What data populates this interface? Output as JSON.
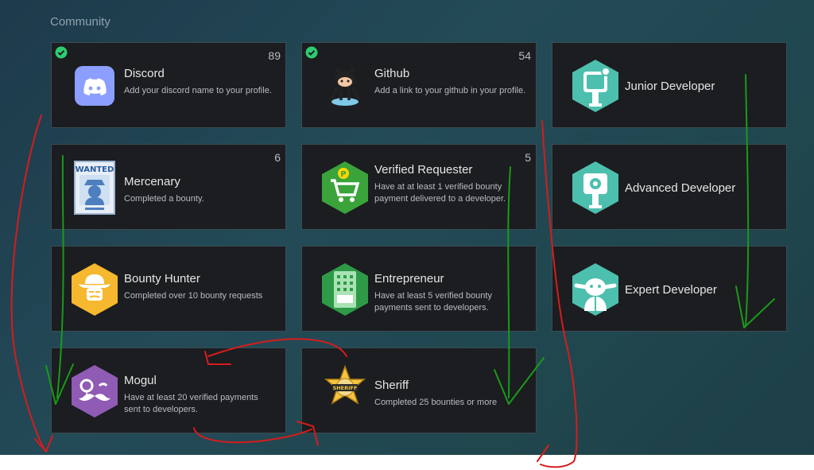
{
  "section_title": "Community",
  "cards": [
    {
      "name": "Discord",
      "desc": "Add your discord name to your profile.",
      "count": "89",
      "checked": true,
      "icon": "discord-icon"
    },
    {
      "name": "Github",
      "desc": "Add a link to your github in your profile.",
      "count": "54",
      "checked": true,
      "icon": "github-octocat-icon"
    },
    {
      "name": "Junior Developer",
      "desc": "",
      "count": "",
      "checked": false,
      "icon": "junior-developer-icon"
    },
    {
      "name": "Mercenary",
      "desc": "Completed a bounty.",
      "count": "6",
      "checked": false,
      "icon": "wanted-poster-icon"
    },
    {
      "name": "Verified Requester",
      "desc": "Have at at least 1 verified bounty payment delivered to a developer.",
      "count": "5",
      "checked": false,
      "icon": "shopping-cart-icon"
    },
    {
      "name": "Advanced Developer",
      "desc": "",
      "count": "",
      "checked": false,
      "icon": "advanced-developer-icon"
    },
    {
      "name": "Bounty Hunter",
      "desc": "Completed over 10 bounty requests",
      "count": "",
      "checked": false,
      "icon": "cowboy-icon"
    },
    {
      "name": "Entrepreneur",
      "desc": "Have at least 5 verified bounty payments sent to developers.",
      "count": "",
      "checked": false,
      "icon": "building-icon"
    },
    {
      "name": "Expert Developer",
      "desc": "",
      "count": "",
      "checked": false,
      "icon": "yoda-icon"
    },
    {
      "name": "Mogul",
      "desc": "Have at least 20 verified payments sent to developers.",
      "count": "",
      "checked": false,
      "icon": "monocle-mustache-icon"
    },
    {
      "name": "Sheriff",
      "desc": "Completed 25 bounties or more",
      "count": "",
      "checked": false,
      "icon": "sheriff-star-icon"
    }
  ],
  "sheriff_badge_text": "SHERIFF",
  "wanted_text": "WANTED",
  "colors": {
    "card_bg": "#1b1d20",
    "card_border": "#3b4b52",
    "check": "#2ecc71",
    "green_annot": "#1a9a1a",
    "red_annot": "#d61c1c"
  }
}
